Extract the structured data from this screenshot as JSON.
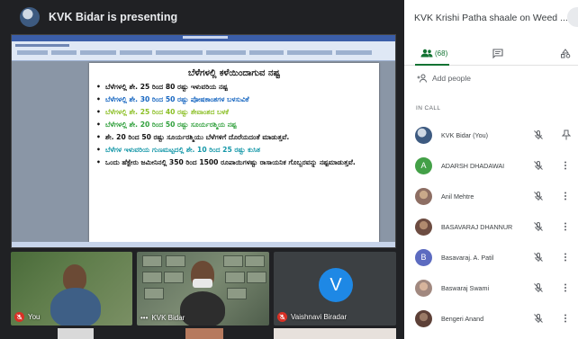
{
  "presenting": {
    "label": "KVK Bidar is presenting"
  },
  "document": {
    "title": "ಬೆಳೆಗಳಲ್ಲಿ ಕಳೆಯಿಂದಾಗುವ ನಷ್ಟ",
    "bullets": [
      {
        "text": "ಬೆಳೆಗಳಲ್ಲಿ ಶೇ. 25 ರಿಂದ 80 ರಷ್ಟು ಇಳುವರಿಯ ನಷ್ಟ",
        "color": "#111111"
      },
      {
        "text": "ಬೆಳೆಗಳಲ್ಲಿ ಶೇ. 30 ರಿಂದ 50 ರಷ್ಟು ಪೋಷಕಾಂಶಗಳ ಬಳಸುವಿಕೆ",
        "color": "#1565c0"
      },
      {
        "text": "ಬೆಳೆಗಳಲ್ಲಿ ಶೇ. 25 ರಿಂದ 40 ರಷ್ಟು ತೇವಾಂಶದ ಬಳಕೆ",
        "color": "#8cbf26"
      },
      {
        "text": "ಬೆಳೆಗಳಲ್ಲಿ ಶೇ. 20 ರಿಂದ 50 ರಷ್ಟು ಸೂರ್ಯರಶ್ಮಿಯ ನಷ್ಟ",
        "color": "#2e9f3a"
      },
      {
        "text": "ಶೇ. 20 ರಿಂದ 50 ರಷ್ಟು ಸೂರ್ಯರಶ್ಮಿಯು ಬೆಳೆಗಳಿಗೆ ದೊರೆಯದಂತೆ ಮಾಡುತ್ತವೆ.",
        "color": "#111111"
      },
      {
        "text": "ಬೆಳೆಗಳ ಇಳುವರಿಯ ಗುಣಮಟ್ಟದಲ್ಲಿ ಶೇ. 10 ರಿಂದ 25 ರಷ್ಟು ಕುಸಿತ",
        "color": "#1296a7"
      },
      {
        "text": "ಒಂದು ಹೆಕ್ಟೇರು ಜಮೀನಿನಲ್ಲಿ 350 ರಿಂದ 1500 ರೂಪಾಯಿಗಳಷ್ಟು ರಾಸಾಯನಿಕ ಗೊಬ್ಬರವನ್ನು ನಷ್ಟಮಾಡುತ್ತವೆ.",
        "color": "#111111"
      }
    ]
  },
  "tiles": [
    {
      "name": "You"
    },
    {
      "name": "KVK Bidar"
    },
    {
      "name": "Vaishnavi Biradar",
      "initial": "V"
    }
  ],
  "panel": {
    "meeting_title": "KVK Krishi Patha shaale on Weed ...",
    "people_count": "(68)",
    "add_people": "Add people",
    "section_label": "IN CALL",
    "participants": [
      {
        "name": "KVK Bidar (You)",
        "avatar": "photo",
        "avatar_color": "#3d5a80"
      },
      {
        "name": "ADARSH DHADAWAI",
        "avatar": "A",
        "avatar_color": "#43a047"
      },
      {
        "name": "Anil Mehtre",
        "avatar": "photo",
        "avatar_color": "#8d6e63"
      },
      {
        "name": "BASAVARAJ DHANNUR",
        "avatar": "photo",
        "avatar_color": "#6d4c41"
      },
      {
        "name": "Basavaraj. A. Patil",
        "avatar": "B",
        "avatar_color": "#5c6bc0"
      },
      {
        "name": "Baswaraj Swami",
        "avatar": "photo",
        "avatar_color": "#a1887f"
      },
      {
        "name": "Bengeri Anand",
        "avatar": "photo",
        "avatar_color": "#5d4037"
      }
    ]
  }
}
